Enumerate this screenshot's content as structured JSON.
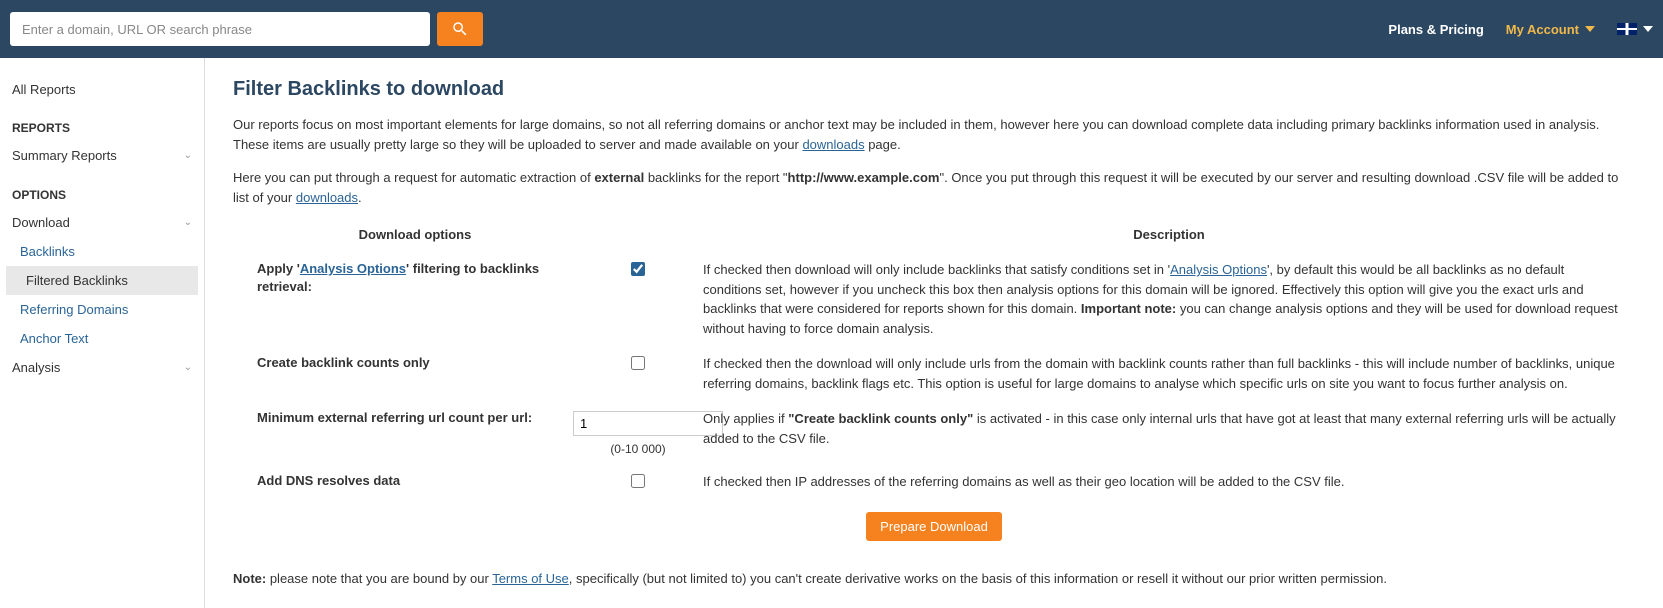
{
  "header": {
    "search_placeholder": "Enter a domain, URL OR search phrase",
    "plans_pricing": "Plans & Pricing",
    "my_account": "My Account"
  },
  "sidebar": {
    "all_reports": "All Reports",
    "reports_heading": "REPORTS",
    "summary_reports": "Summary Reports",
    "options_heading": "OPTIONS",
    "download": "Download",
    "download_sub": {
      "backlinks": "Backlinks",
      "filtered_backlinks": "Filtered Backlinks",
      "referring_domains": "Referring Domains",
      "anchor_text": "Anchor Text"
    },
    "analysis": "Analysis"
  },
  "page": {
    "title": "Filter Backlinks to download",
    "intro_part1": "Our reports focus on most important elements for large domains, so not all referring domains or anchor text may be included in them, however here you can download complete data including primary backlinks information used in analysis. These items are usually pretty large so they will be uploaded to server and made available on your ",
    "intro_downloads_link": "downloads",
    "intro_part2": " page.",
    "req_part1": "Here you can put through a request for automatic extraction of ",
    "req_external": "external",
    "req_part2": " backlinks for the report \"",
    "req_url": "http://www.example.com",
    "req_part3": "\". Once you put through this request it will be executed by our server and resulting download .CSV file will be added to list of your ",
    "req_downloads_link": "downloads",
    "req_part4": "."
  },
  "table": {
    "head_options": "Download options",
    "head_description": "Description",
    "row1": {
      "label_pre": "Apply '",
      "label_link": "Analysis Options",
      "label_post": "' filtering to backlinks retrieval:",
      "desc_pre": "If checked then download will only include backlinks that satisfy conditions set in '",
      "desc_link": "Analysis Options",
      "desc_mid": "', by default this would be all backlinks as no default conditions set, however if you uncheck this box then analysis options for this domain will be ignored. Effectively this option will give you the exact urls and backlinks that were considered for reports shown for this domain. ",
      "desc_bold": "Important note:",
      "desc_post": " you can change analysis options and they will be used for download request without having to force domain analysis."
    },
    "row2": {
      "label": "Create backlink counts only",
      "desc": "If checked then the download will only include urls from the domain with backlink counts rather than full backlinks - this will include number of backlinks, unique referring domains, backlink flags etc. This option is useful for large domains to analyse which specific urls on site you want to focus further analysis on."
    },
    "row3": {
      "label": "Minimum external referring url count per url:",
      "value": "1",
      "range": "(0-10 000)",
      "desc_pre": "Only applies if ",
      "desc_bold": "\"Create backlink counts only\"",
      "desc_post": " is activated - in this case only internal urls that have got at least that many external referring urls will be actually added to the CSV file."
    },
    "row4": {
      "label": "Add DNS resolves data",
      "desc": "If checked then IP addresses of the referring domains as well as their geo location will be added to the CSV file."
    },
    "prepare_btn": "Prepare Download"
  },
  "footer": {
    "note_bold": "Note:",
    "note_pre": " please note that you are bound by our ",
    "note_link": "Terms of Use",
    "note_post": ", specifically (but not limited to) you can't create derivative works on the basis of this information or resell it without our prior written permission."
  }
}
